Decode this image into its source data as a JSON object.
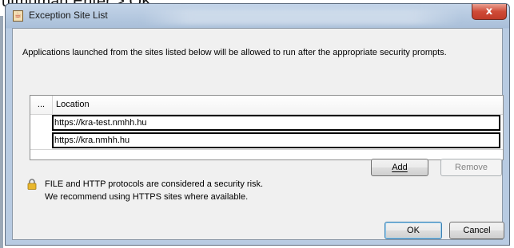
{
  "background": {
    "caption": "utmuman Enter > OK"
  },
  "window": {
    "title": "Exception Site List",
    "close_symbol": "x",
    "icon_name": "java-icon"
  },
  "description": "Applications launched from the sites listed below will be allowed to run after the appropriate security prompts.",
  "table": {
    "headers": [
      "...",
      "Location"
    ],
    "rows": [
      "https://kra-test.nmhh.hu",
      "https://kra.nmhh.hu"
    ]
  },
  "buttons": {
    "add": "Add",
    "remove": "Remove",
    "ok": "OK",
    "cancel": "Cancel"
  },
  "warning": {
    "line1": "FILE and HTTP protocols are considered a security risk.",
    "line2": "We recommend using HTTPS sites where available."
  }
}
